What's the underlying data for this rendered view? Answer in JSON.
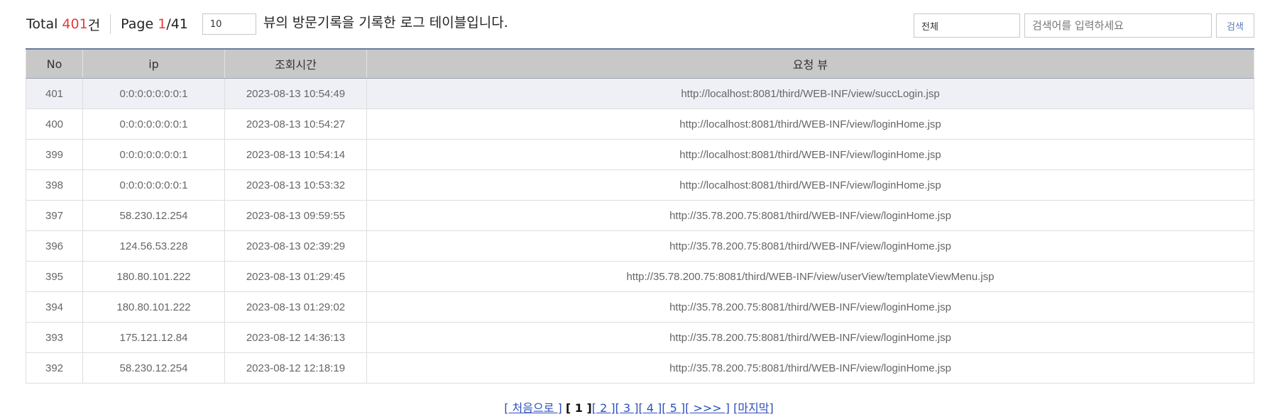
{
  "header": {
    "total_label": "Total",
    "total_count": "401",
    "total_unit": "건",
    "page_label": "Page",
    "page_current": "1",
    "page_total": "/41",
    "page_size_value": "10",
    "description": "뷰의 방문기록을 기록한 로그 테이블입니다."
  },
  "search": {
    "category_value": "전체",
    "keyword_placeholder": "검색어를 입력하세요",
    "button_label": "검색"
  },
  "table": {
    "columns": [
      "No",
      "ip",
      "조회시간",
      "요청 뷰"
    ],
    "rows": [
      [
        "401",
        "0:0:0:0:0:0:0:1",
        "2023-08-13 10:54:49",
        "http://localhost:8081/third/WEB-INF/view/succLogin.jsp"
      ],
      [
        "400",
        "0:0:0:0:0:0:0:1",
        "2023-08-13 10:54:27",
        "http://localhost:8081/third/WEB-INF/view/loginHome.jsp"
      ],
      [
        "399",
        "0:0:0:0:0:0:0:1",
        "2023-08-13 10:54:14",
        "http://localhost:8081/third/WEB-INF/view/loginHome.jsp"
      ],
      [
        "398",
        "0:0:0:0:0:0:0:1",
        "2023-08-13 10:53:32",
        "http://localhost:8081/third/WEB-INF/view/loginHome.jsp"
      ],
      [
        "397",
        "58.230.12.254",
        "2023-08-13 09:59:55",
        "http://35.78.200.75:8081/third/WEB-INF/view/loginHome.jsp"
      ],
      [
        "396",
        "124.56.53.228",
        "2023-08-13 02:39:29",
        "http://35.78.200.75:8081/third/WEB-INF/view/loginHome.jsp"
      ],
      [
        "395",
        "180.80.101.222",
        "2023-08-13 01:29:45",
        "http://35.78.200.75:8081/third/WEB-INF/view/userView/templateViewMenu.jsp"
      ],
      [
        "394",
        "180.80.101.222",
        "2023-08-13 01:29:02",
        "http://35.78.200.75:8081/third/WEB-INF/view/loginHome.jsp"
      ],
      [
        "393",
        "175.121.12.84",
        "2023-08-12 14:36:13",
        "http://35.78.200.75:8081/third/WEB-INF/view/loginHome.jsp"
      ],
      [
        "392",
        "58.230.12.254",
        "2023-08-12 12:18:19",
        "http://35.78.200.75:8081/third/WEB-INF/view/loginHome.jsp"
      ]
    ]
  },
  "pagination": {
    "first": "[ 처음으로 ]",
    "current": "[ 1 ]",
    "pages": [
      "[ 2 ]",
      "[ 3 ]",
      "[ 4 ]",
      "[ 5 ]"
    ],
    "next": "[ >>> ]",
    "last": "[마지막]"
  },
  "colors": {
    "accent_red": "#e53b3b",
    "header_bg": "#c8c8c8",
    "highlight_row": "#eef0f6",
    "link_blue": "#2d4fbd"
  }
}
